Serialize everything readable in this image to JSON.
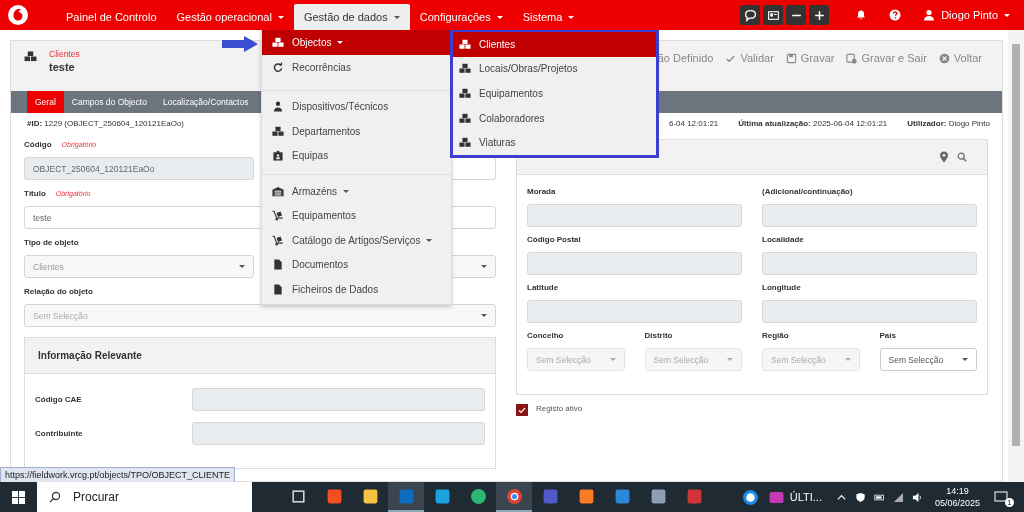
{
  "navbar": {
    "items": [
      {
        "label": "Painel de Controlo",
        "caret": false,
        "selected": false
      },
      {
        "label": "Gestão operacional",
        "caret": true,
        "selected": false
      },
      {
        "label": "Gestão de dados",
        "caret": true,
        "selected": true
      },
      {
        "label": "Configurações",
        "caret": true,
        "selected": false
      },
      {
        "label": "Sistema",
        "caret": true,
        "selected": false
      }
    ],
    "user": "Diogo Pinto"
  },
  "menu": {
    "groups": [
      [
        {
          "label": "Objectos",
          "kind": "cubes",
          "caret": true,
          "selected": true
        },
        {
          "label": "Recorrências",
          "kind": "refresh",
          "caret": false,
          "selected": false
        }
      ],
      [
        {
          "label": "Dispositivos/Técnicos",
          "kind": "user",
          "caret": false,
          "selected": false
        },
        {
          "label": "Departamentos",
          "kind": "cubes",
          "caret": false,
          "selected": false
        },
        {
          "label": "Equipas",
          "kind": "badge",
          "caret": false,
          "selected": false
        }
      ],
      [
        {
          "label": "Armazéns",
          "kind": "warehouse",
          "caret": true,
          "selected": false
        },
        {
          "label": "Equipamentos",
          "kind": "dolly",
          "caret": false,
          "selected": false
        },
        {
          "label": "Catálogo de Artigos/Serviços",
          "kind": "dolly",
          "caret": true,
          "selected": false
        },
        {
          "label": "Documentos",
          "kind": "file",
          "caret": false,
          "selected": false
        },
        {
          "label": "Ficheiros de Dados",
          "kind": "file",
          "caret": false,
          "selected": false
        }
      ]
    ],
    "submenu": [
      {
        "label": "Clientes",
        "selected": true
      },
      {
        "label": "Locais/Obras/Projetos",
        "selected": false
      },
      {
        "label": "Equipamentos",
        "selected": false
      },
      {
        "label": "Colaboradores",
        "selected": false
      },
      {
        "label": "Viaturas",
        "selected": false
      }
    ]
  },
  "header": {
    "category": "Clientes",
    "title": "teste",
    "actions": [
      {
        "label": "ão Definido",
        "kind": "none"
      },
      {
        "label": "Validar",
        "kind": "check"
      },
      {
        "label": "Gravar",
        "kind": "save"
      },
      {
        "label": "Gravar e Sair",
        "kind": "save-exit"
      },
      {
        "label": "Voltar",
        "kind": "back"
      }
    ]
  },
  "tabs": [
    {
      "label": "Geral",
      "selected": true
    },
    {
      "label": "Campos do Objecto",
      "selected": false
    },
    {
      "label": "Localização/Contactos",
      "selected": false
    }
  ],
  "info": {
    "left": "**#ID:** 1229 (OBJECT_250604_120121EaOo)",
    "right": [
      "6-04 12:01:21",
      "**Última atualização:** 2025-06-04 12:01:21",
      "**Utilizador:** Diogo Pinto"
    ]
  },
  "form": [
    {
      "label": "Código",
      "required": "Obrigatório",
      "fields": [
        {
          "kind": "readonly",
          "value": "OBJECT_250604_120121EaOo"
        },
        {
          "kind": "input"
        }
      ]
    },
    {
      "label": "Título",
      "required": "Obrigatório",
      "fields": [
        {
          "kind": "input",
          "value": "teste"
        }
      ]
    },
    {
      "label": "Tipo de objeto",
      "fields": [
        {
          "kind": "select",
          "value": "Clientes"
        },
        {
          "kind": "select"
        }
      ]
    },
    {
      "label": "Relação do objeto",
      "fields": [
        {
          "kind": "select",
          "placeholder": "Sem Selecção"
        }
      ]
    }
  ],
  "relevant": {
    "title": "Informação Relevante",
    "fields": [
      "Código CAE",
      "Contribuinte"
    ]
  },
  "location": {
    "rows": [
      [
        {
          "label": "Morada",
          "kind": "input"
        },
        {
          "label": "(Adicional/continuação)",
          "kind": "input"
        }
      ],
      [
        {
          "label": "Código Postal",
          "kind": "input"
        },
        {
          "label": "Localidade",
          "kind": "input"
        }
      ],
      [
        {
          "label": "Latitude",
          "kind": "input"
        },
        {
          "label": "Longitude",
          "kind": "input"
        }
      ],
      [
        {
          "label": "Concelho",
          "kind": "select",
          "placeholder": "Sem Selecção",
          "disabled": true
        },
        {
          "label": "Distrito",
          "kind": "select",
          "placeholder": "Sem Selecção",
          "disabled": true
        },
        {
          "label": "Região",
          "kind": "select",
          "placeholder": "Sem Selecção",
          "disabled": true
        },
        {
          "label": "País",
          "kind": "select",
          "value": "Sem Selecção",
          "disabled": false
        }
      ]
    ]
  },
  "active_record": {
    "label": "Registo ativo",
    "checked": true
  },
  "status_url": "https://fieldwork.vrcg.pt/objects/TPO/OBJECT_CLIENTE",
  "taskbar": {
    "search": {
      "placeholder": "Procurar"
    },
    "apps": [
      {
        "kind": "taskview",
        "active": false
      },
      {
        "kind": "store",
        "active": false
      },
      {
        "kind": "folder",
        "active": false
      },
      {
        "kind": "outlook",
        "active": true
      },
      {
        "kind": "mdp",
        "active": false
      },
      {
        "kind": "edge",
        "active": false
      },
      {
        "kind": "chrome",
        "active": true
      },
      {
        "kind": "teams",
        "active": false
      },
      {
        "kind": "xampp",
        "active": false
      },
      {
        "kind": "photos",
        "active": false
      },
      {
        "kind": "paint",
        "active": false
      },
      {
        "kind": "scissors",
        "active": false
      }
    ],
    "tray_app": "ÚLTI...",
    "time": "14:19",
    "date": "05/06/2025",
    "notifications": "1"
  }
}
